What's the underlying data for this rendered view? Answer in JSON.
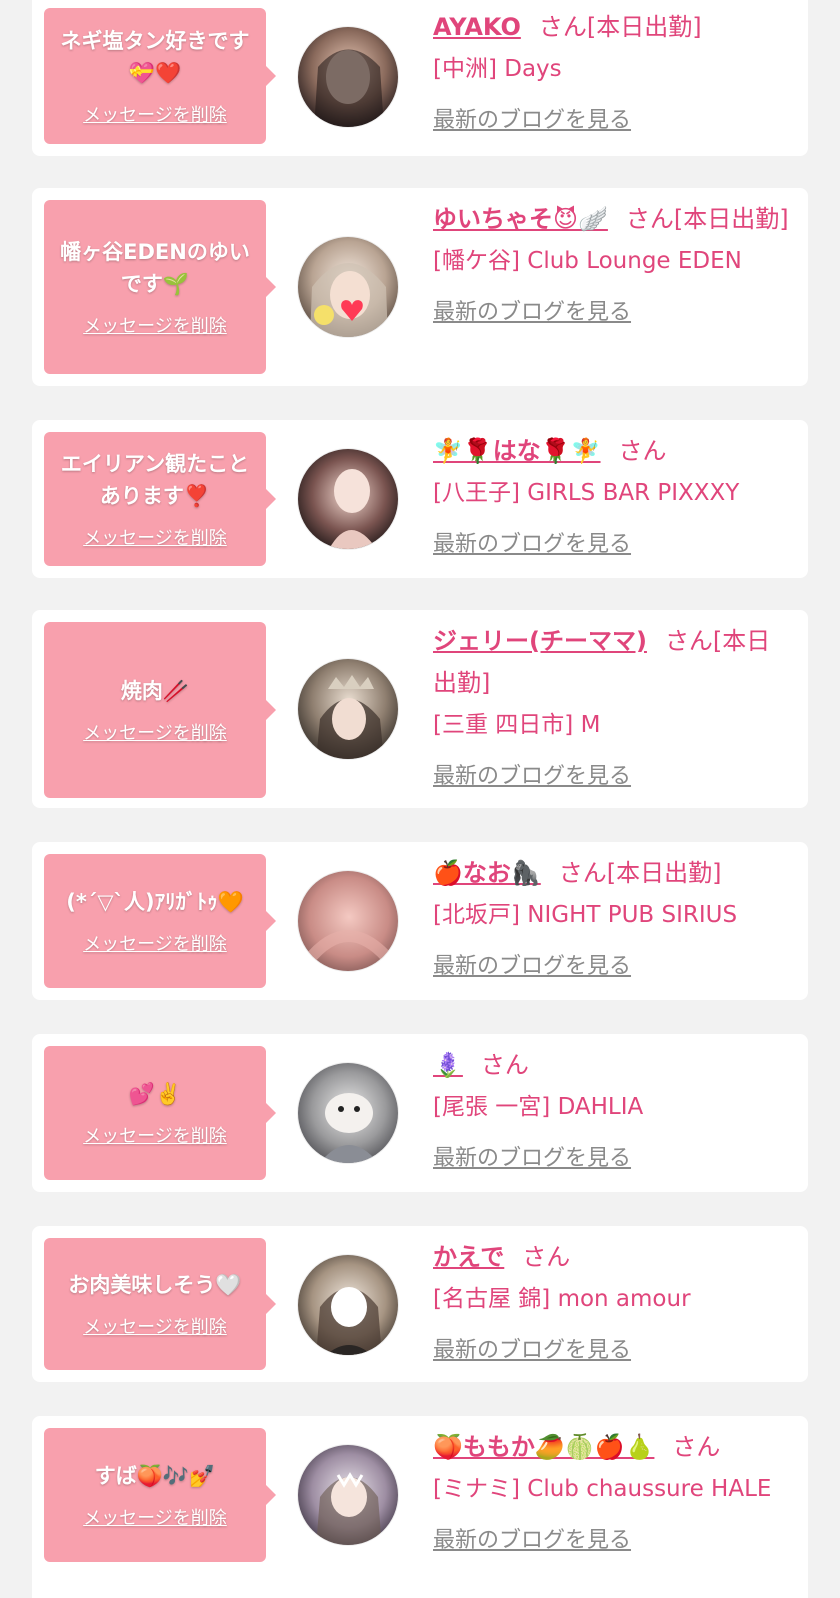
{
  "delete_label": "メッセージを削除",
  "blog_label": "最新のブログを見る",
  "san_suffix": "さん",
  "colors": {
    "bubble": "#f8a0ad",
    "accent": "#e0457b",
    "link_gray": "#8a8a8a",
    "background": "#f2f2f2"
  },
  "cards": [
    {
      "message": "ネギ塩タン好きです💝❤️",
      "name": "AYAKO",
      "status": "さん[本日出勤]",
      "shop": "[中洲] Days"
    },
    {
      "message": "幡ヶ谷EDENのゆいです🌱",
      "name": "ゆいちゃそ😈🪽",
      "status": "さん[本日出勤]",
      "shop": "[幡ケ谷] Club Lounge EDEN"
    },
    {
      "message": "エイリアン観たことあります❣️",
      "name": "🧚🌹はな🌹🧚",
      "status": "さん",
      "shop": "[八王子] GIRLS BAR PIXXXY"
    },
    {
      "message": "焼肉🥢",
      "name": "ジェリー(チーママ)",
      "status": "さん[本日出勤]",
      "shop": "[三重 四日市] M"
    },
    {
      "message": "(*ˊ▽ˋ人)ｱﾘｶﾞﾄｩ🧡",
      "name": "🍎なお🦍",
      "status": "さん[本日出勤]",
      "shop": "[北坂戸] NIGHT PUB SIRIUS"
    },
    {
      "message": "💕✌️",
      "name": "🪻",
      "status": "さん",
      "shop": "[尾張 一宮] DAHLIA"
    },
    {
      "message": "お肉美味しそう🤍",
      "name": "かえで",
      "status": "さん",
      "shop": "[名古屋 錦] mon amour"
    },
    {
      "message": "すば🍑🎶💅",
      "name": "🍑ももか🥭🍈🍎🍐",
      "status": "さん",
      "shop": "[ミナミ] Club chaussure HALE"
    }
  ]
}
